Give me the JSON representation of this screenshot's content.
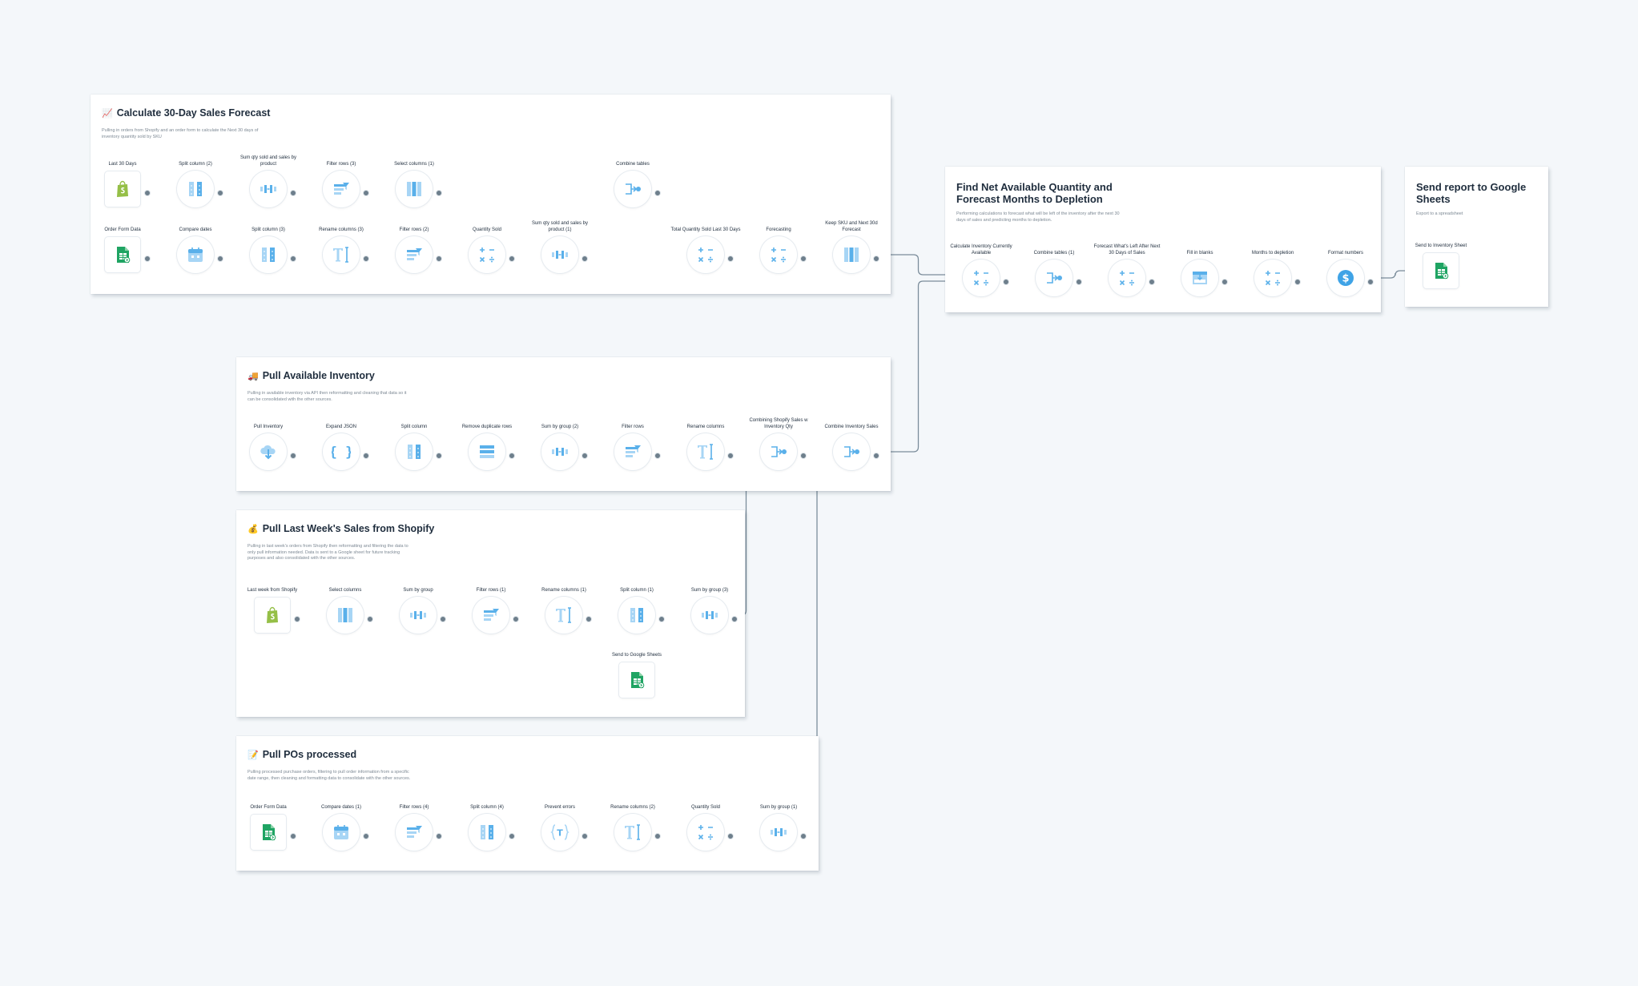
{
  "colors": {
    "wire": "#7b8d9b",
    "icon": "#5ab0ea",
    "icon_light": "#a7d5f5",
    "sheets": "#1fa463",
    "shopify": "#95bf47",
    "dollar": "#3fa3e6"
  },
  "panels": [
    {
      "emoji": "📈",
      "title": "Calculate 30-Day Sales Forecast",
      "description": "Pulling in orders from Shopify and an order form to calculate the Next 30 days of inventory quantity sold by SKU"
    },
    {
      "emoji": "",
      "title": "Find Net Available Quantity and Forecast Months to Depletion",
      "description": "Performing calculations to forecast what will be left of the inventory after the next 30 days of sales and predicting months to depletion."
    },
    {
      "emoji": "",
      "title": "Send report to Google Sheets",
      "description": "Export to a spreadsheet"
    },
    {
      "emoji": "🚚",
      "title": "Pull Available Inventory",
      "description": "Pulling in available inventory via API then reformatting and cleaning that data so it can be consolidated with the other sources."
    },
    {
      "emoji": "💰",
      "title": "Pull Last Week's Sales from Shopify",
      "description": "Pulling in last week's orders from Shopify then reformatting and filtering the data to only pull information needed. Data is sent to a Google sheet for future tracking purposes and also consolidated with the other sources."
    },
    {
      "emoji": "📝",
      "title": "Pull POs processed",
      "description": "Pulling processed purchase orders, filtering to pull order information from a specific date range, then cleaning and formatting data to consolidate with the other sources."
    }
  ],
  "nodes": [
    {
      "label": "Last 30 Days",
      "icon": "shopify-icon"
    },
    {
      "label": "Split column (2)",
      "icon": "split-column-icon"
    },
    {
      "label": "Sum qty sold and sales by product",
      "icon": "sum-by-group-icon"
    },
    {
      "label": "Filter rows (3)",
      "icon": "filter-rows-icon"
    },
    {
      "label": "Select columns (1)",
      "icon": "select-columns-icon"
    },
    {
      "label": "Combine tables",
      "icon": "combine-tables-icon"
    },
    {
      "label": "Order Form Data",
      "icon": "google-sheets-icon"
    },
    {
      "label": "Compare dates",
      "icon": "calendar-icon"
    },
    {
      "label": "Split column (3)",
      "icon": "split-column-icon"
    },
    {
      "label": "Rename columns (3)",
      "icon": "rename-columns-icon"
    },
    {
      "label": "Filter rows (2)",
      "icon": "filter-rows-icon"
    },
    {
      "label": "Quantity Sold",
      "icon": "math-icon"
    },
    {
      "label": "Sum qty sold and sales by product (1)",
      "icon": "sum-by-group-icon"
    },
    {
      "label": "Total Quantity Sold Last 30 Days",
      "icon": "math-icon"
    },
    {
      "label": "Forecasting",
      "icon": "math-icon"
    },
    {
      "label": "Keep SKU and Next 30d Forecast",
      "icon": "select-columns-icon"
    },
    {
      "label": "Calculate Inventory Currently Available",
      "icon": "math-icon"
    },
    {
      "label": "Combine tables (1)",
      "icon": "combine-tables-icon"
    },
    {
      "label": "Forecast What's Left After Next 30 Days of Sales",
      "icon": "math-icon"
    },
    {
      "label": "Fill in blanks",
      "icon": "fill-blanks-icon"
    },
    {
      "label": "Months to depletion",
      "icon": "math-icon"
    },
    {
      "label": "Format numbers",
      "icon": "dollar-icon"
    },
    {
      "label": "Send to Inventory Sheet",
      "icon": "google-sheets-icon"
    },
    {
      "label": "Pull Inventory",
      "icon": "cloud-download-icon"
    },
    {
      "label": "Expand JSON",
      "icon": "json-braces-icon"
    },
    {
      "label": "Split column",
      "icon": "split-column-icon"
    },
    {
      "label": "Remove duplicate rows",
      "icon": "remove-duplicates-icon"
    },
    {
      "label": "Sum by group (2)",
      "icon": "sum-by-group-icon"
    },
    {
      "label": "Filter rows",
      "icon": "filter-rows-icon"
    },
    {
      "label": "Rename columns",
      "icon": "rename-columns-icon"
    },
    {
      "label": "Combining Shopify Sales w Inventory Qty",
      "icon": "combine-tables-icon"
    },
    {
      "label": "Combine Inventory Sales",
      "icon": "combine-tables-icon"
    },
    {
      "label": "Last week from Shopify",
      "icon": "shopify-icon"
    },
    {
      "label": "Select columns",
      "icon": "select-columns-icon"
    },
    {
      "label": "Sum by group",
      "icon": "sum-by-group-icon"
    },
    {
      "label": "Filter rows (1)",
      "icon": "filter-rows-icon"
    },
    {
      "label": "Rename columns (1)",
      "icon": "rename-columns-icon"
    },
    {
      "label": "Split column (1)",
      "icon": "split-column-icon"
    },
    {
      "label": "Sum by group (3)",
      "icon": "sum-by-group-icon"
    },
    {
      "label": "Send to Google Sheets",
      "icon": "google-sheets-icon"
    },
    {
      "label": "Order Form Data",
      "icon": "google-sheets-icon"
    },
    {
      "label": "Compare dates (1)",
      "icon": "calendar-icon"
    },
    {
      "label": "Filter rows (4)",
      "icon": "filter-rows-icon"
    },
    {
      "label": "Split column (4)",
      "icon": "split-column-icon"
    },
    {
      "label": "Prevent errors",
      "icon": "prevent-errors-icon"
    },
    {
      "label": "Rename columns (2)",
      "icon": "rename-columns-icon"
    },
    {
      "label": "Quantity Sold",
      "icon": "math-icon"
    },
    {
      "label": "Sum by group (1)",
      "icon": "sum-by-group-icon"
    }
  ]
}
